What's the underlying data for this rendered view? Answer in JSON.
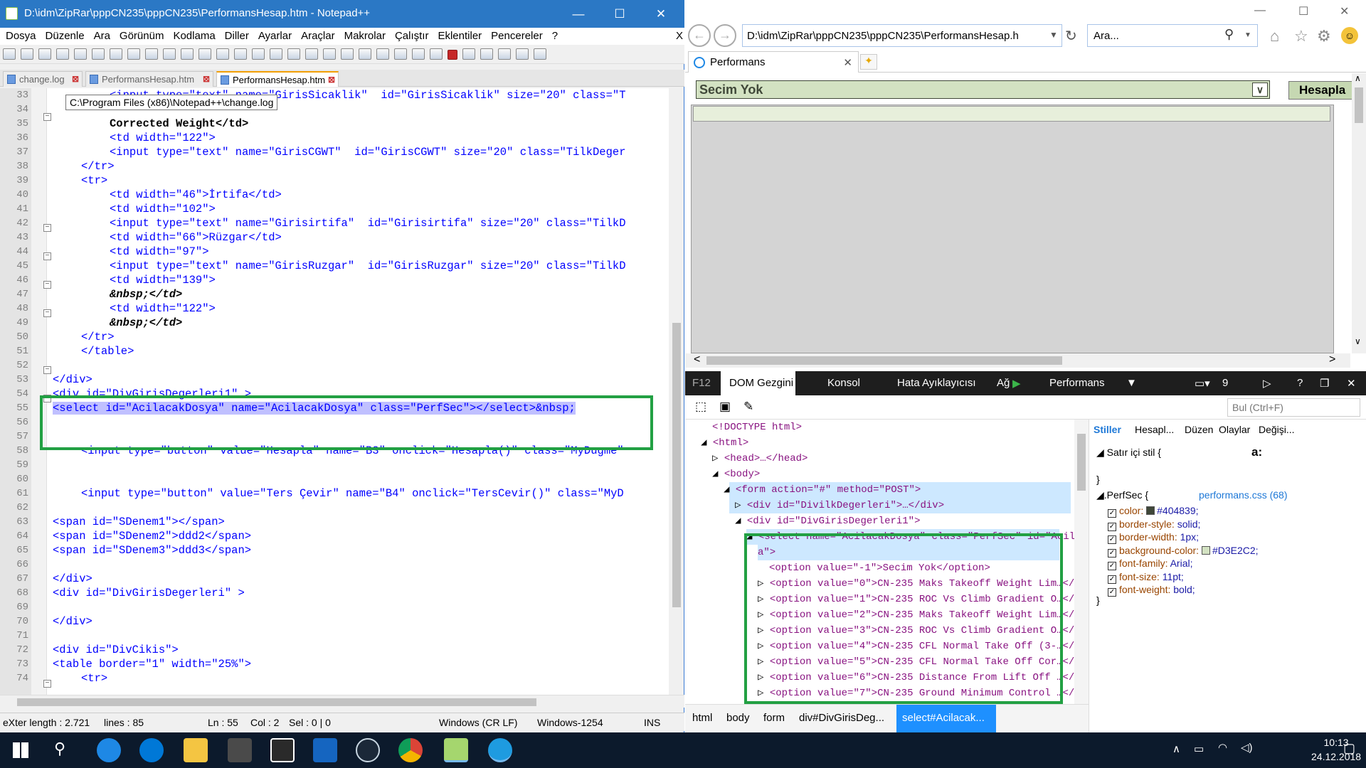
{
  "npp": {
    "title": "D:\\idm\\ZipRar\\pppCN235\\pppCN235\\PerformansHesap.htm - Notepad++",
    "menu": [
      "Dosya",
      "Düzenle",
      "Ara",
      "Görünüm",
      "Kodlama",
      "Diller",
      "Ayarlar",
      "Araçlar",
      "Makrolar",
      "Çalıştır",
      "Eklentiler",
      "Pencereler",
      "?"
    ],
    "menu_close": "X",
    "tabs": [
      "change.log",
      "PerformansHesap.htm",
      "PerformansHesap.htm"
    ],
    "tooltip": "C:\\Program Files (x86)\\Notepad++\\change.log",
    "line_numbers": [
      "33",
      "34",
      "35",
      "36",
      "37",
      "38",
      "39",
      "40",
      "41",
      "42",
      "43",
      "44",
      "45",
      "46",
      "47",
      "48",
      "49",
      "50",
      "51",
      "52",
      "53",
      "54",
      "55",
      "56",
      "57",
      "58",
      "59",
      "60",
      "61",
      "62",
      "63",
      "64",
      "65",
      "66",
      "67",
      "68",
      "69",
      "70",
      "71",
      "72",
      "73",
      "74"
    ],
    "code": {
      "l33": "<input type=\"text\" name=\"GirisSicaklik\"  id=\"GirisSicaklik\" size=\"20\" class=\"T",
      "l35": "Corrected Weight</td>",
      "l36": "<td width=\"122\">",
      "l37": "<input type=\"text\" name=\"GirisCGWT\"  id=\"GirisCGWT\" size=\"20\" class=\"TilkDeger",
      "l38": "</tr>",
      "l39": "<tr>",
      "l40": "<td width=\"46\">İrtifa</td>",
      "l41": "<td width=\"102\">",
      "l42": "<input type=\"text\" name=\"Girisirtifa\"  id=\"Girisirtifa\" size=\"20\" class=\"TilkD",
      "l43": "<td width=\"66\">Rüzgar</td>",
      "l44": "<td width=\"97\">",
      "l45": "<input type=\"text\" name=\"GirisRuzgar\"  id=\"GirisRuzgar\" size=\"20\" class=\"TilkD",
      "l46": "<td width=\"139\">",
      "l47": "&nbsp;</td>",
      "l48": "<td width=\"122\">",
      "l49": "&nbsp;</td>",
      "l50": "</tr>",
      "l51": "</table>",
      "l53": "</div>",
      "l54": "<div id=\"DivGirisDegerleri1\" >",
      "l55": "<select id=\"AcilacakDosya\" name=\"AcilacakDosya\" class=\"PerfSec\"></select>&nbsp;",
      "l58": "<input type=\"button\" value=\"Hesapla\" name=\"B3\" onclick=\"Hesapla()\" class=\"MyDugme\"",
      "l61": "<input type=\"button\" value=\"Ters Çevir\" name=\"B4\" onclick=\"TersCevir()\" class=\"MyD",
      "l63": "<span id=\"SDenem1\"></span>",
      "l64": "<span id=\"SDenem2\">ddd2</span>",
      "l65": "<span id=\"SDenem3\">ddd3</span>",
      "l67": "</div>",
      "l68": "<div id=\"DivGirisDegerleri\" >",
      "l70": "</div>",
      "l72": "<div id=\"DivCikis\">",
      "l73": "<table border=\"1\" width=\"25%\">",
      "l74": "<tr>"
    },
    "status": {
      "length": "eXter length : 2.721",
      "lines": "lines : 85",
      "ln": "Ln : 55",
      "col": "Col : 2",
      "sel": "Sel : 0 | 0",
      "eol": "Windows (CR LF)",
      "encoding": "Windows-1254",
      "mode": "INS"
    }
  },
  "ie": {
    "address": "D:\\idm\\ZipRar\\pppCN235\\pppCN235\\PerformansHesap.h",
    "search_placeholder": "Ara...",
    "tab_title": "Performans",
    "select_value": "Secim Yok",
    "hesapla_label": "Hesapla"
  },
  "devtools": {
    "tabs": [
      "F12",
      "DOM Gezgini",
      "Konsol",
      "Hata Ayıklayıcısı",
      "Ağ",
      "Performans"
    ],
    "error_count": "9",
    "find_placeholder": "Bul (Ctrl+F)",
    "dom_lines": [
      "<!DOCTYPE html>",
      "<html>",
      "<head>…</head>",
      "<body>",
      "<form action=\"#\" method=\"POST\">",
      "<div id=\"DivilkDegerleri\">…</div>",
      "<div id=\"DivGirisDegerleri1\">",
      "<select name=\"AcilacakDosya\" class=\"PerfSec\" id=\"AcilacakDosy",
      "a\">",
      "<option value=\"-1\">Secim Yok</option>",
      "<option value=\"0\">CN-235 Maks Takeoff Weight Lim…</option>",
      "<option value=\"1\">CN-235 ROC Vs Climb Gradient O…</option>",
      "<option value=\"2\">CN-235 Maks Takeoff Weight Lim…</option>",
      "<option value=\"3\">CN-235 ROC Vs Climb Gradient O…</option>",
      "<option value=\"4\">CN-235 CFL Normal Take Off (3-…</option>",
      "<option value=\"5\">CN-235 CFL Normal Take Off Cor…</option>",
      "<option value=\"6\">CN-235 Distance From Lift Off …</option>",
      "<option value=\"7\">CN-235 Ground Minimum Control …</option>"
    ],
    "styles_tabs": [
      "Stiller",
      "Hesapl...",
      "Düzen",
      "Olaylar",
      "Değişi..."
    ],
    "inline_style": "Satır içi stil  {",
    "inline_close": "}",
    "rule_selector": ".PerfSec  {",
    "rule_source": "performans.css (68)",
    "props": [
      {
        "name": "color:",
        "value": "#404839;",
        "swatch": "#404839"
      },
      {
        "name": "border-style:",
        "value": "solid;",
        "swatch": ""
      },
      {
        "name": "border-width:",
        "value": "1px;",
        "swatch": ""
      },
      {
        "name": "background-color:",
        "value": "#D3E2C2;",
        "swatch": "#D3E2C2"
      },
      {
        "name": "font-family:",
        "value": "Arial;",
        "swatch": ""
      },
      {
        "name": "font-size:",
        "value": "11pt;",
        "swatch": ""
      },
      {
        "name": "font-weight:",
        "value": "bold;",
        "swatch": ""
      }
    ],
    "rule_close": "}",
    "crumbs": [
      "html",
      "body",
      "form",
      "div#DivGirisDeg...",
      "select#Acilacak..."
    ]
  },
  "taskbar": {
    "time": "10:13",
    "date": "24.12.2018"
  }
}
